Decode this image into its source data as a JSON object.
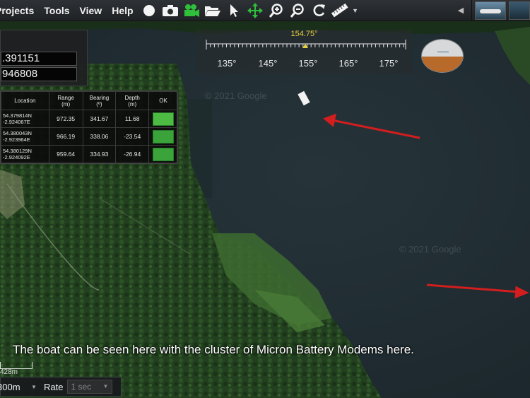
{
  "menu": {
    "items": [
      "Projects",
      "Tools",
      "View",
      "Help"
    ]
  },
  "toolbar": {
    "icons": [
      "record-circle-icon",
      "camera-icon",
      "video-camera-icon",
      "open-folder-icon",
      "pointer-icon",
      "pan-move-icon",
      "zoom-in-icon",
      "zoom-out-icon",
      "refresh-icon",
      "ruler-icon"
    ],
    "accent": "#2fbf3a"
  },
  "coordinates": {
    "value_1": ".391151",
    "value_2": "946808"
  },
  "modem_table": {
    "headers": [
      "Location",
      "Range\n(m)",
      "Bearing\n(º)",
      "Depth\n(m)",
      "OK"
    ],
    "rows": [
      {
        "location_lat": "54.379814N",
        "location_lon": "-2.924067E",
        "range": "972.35",
        "bearing": "341.67",
        "depth": "11.68"
      },
      {
        "location_lat": "54.380043N",
        "location_lon": "-2.923964E",
        "range": "966.19",
        "bearing": "338.06",
        "depth": "-23.54"
      },
      {
        "location_lat": "54.380129N",
        "location_lon": "-2.924092E",
        "range": "959.64",
        "bearing": "334.93",
        "depth": "-26.94"
      }
    ],
    "ok_color": "#3aa33a"
  },
  "heading": {
    "value": "154.75°",
    "ticks": [
      "135°",
      "145°",
      "155°",
      "165°",
      "175°"
    ]
  },
  "map": {
    "watermark": "© 2021 Google",
    "caption": "The boat can be seen here with the cluster of Micron Battery Modems here.",
    "arrow_color": "#d21e1e"
  },
  "scale": {
    "label": "428m"
  },
  "bottom_bar": {
    "range_value": "300m",
    "rate_label": "Rate",
    "rate_value": "1 sec"
  }
}
